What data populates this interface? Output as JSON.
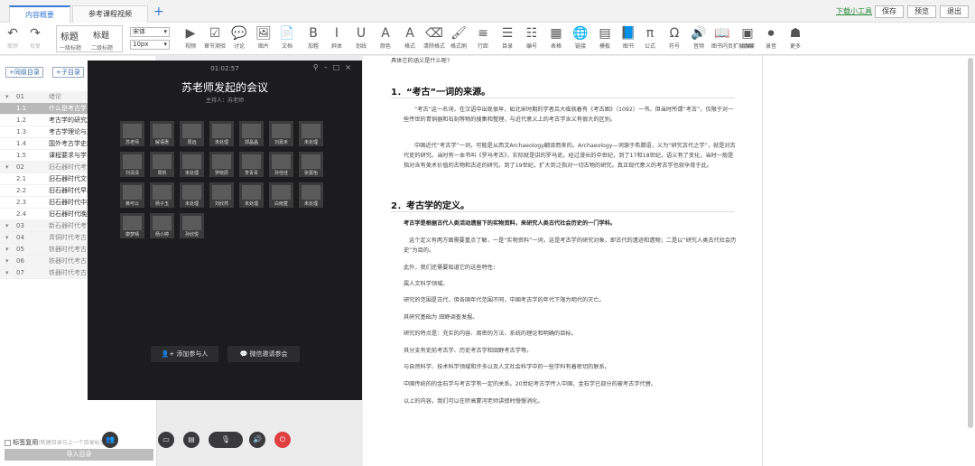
{
  "tabs": [
    "内容概要",
    "参考课程视频"
  ],
  "top_actions": {
    "tool": "下载小工具",
    "save": "保存",
    "preview": "预览",
    "exit": "退出"
  },
  "toolbar": {
    "undo": "撤销",
    "redo": "恢复",
    "style_labels": {
      "h1": "标题",
      "h2": "标题",
      "h1_sub": "一级标题",
      "h2_sub": "二级标题"
    },
    "font": "宋体",
    "size": "10px",
    "items": [
      {
        "g": "▶",
        "l": "视频"
      },
      {
        "g": "☑",
        "l": "章节测验"
      },
      {
        "g": "💬",
        "l": "讨论"
      },
      {
        "g": "🖼",
        "l": "图片"
      },
      {
        "g": "📄",
        "l": "文档"
      },
      {
        "g": "B",
        "l": "加粗"
      },
      {
        "g": "I",
        "l": "斜体"
      },
      {
        "g": "U",
        "l": "划线"
      },
      {
        "g": "A",
        "l": "颜色"
      },
      {
        "g": "A",
        "l": "格式"
      },
      {
        "g": "⌫",
        "l": "清除格式"
      },
      {
        "g": "🖌",
        "l": "格式刷"
      },
      {
        "g": "≡",
        "l": "行距"
      },
      {
        "g": "☰",
        "l": "目录"
      },
      {
        "g": "☷",
        "l": "编号"
      },
      {
        "g": "▦",
        "l": "表格"
      },
      {
        "g": "🌐",
        "l": "链接"
      },
      {
        "g": "▤",
        "l": "模板"
      },
      {
        "g": "📘",
        "l": "图书"
      },
      {
        "g": "π",
        "l": "公式"
      },
      {
        "g": "Ω",
        "l": "符号"
      },
      {
        "g": "🔊",
        "l": "音频"
      },
      {
        "g": "📖",
        "l": "图书内页扩展阅读"
      },
      {
        "g": "▣",
        "l": "动画"
      },
      {
        "g": "⏺",
        "l": "录音"
      },
      {
        "g": "☗",
        "l": "更多"
      }
    ]
  },
  "left": {
    "add_chapter": "+同级目录",
    "add_sub": "+子目录",
    "rows": [
      {
        "n": "01",
        "t": "绪论",
        "k": "ch"
      },
      {
        "n": "1.1",
        "t": "什么是考古学",
        "k": "sel"
      },
      {
        "n": "1.2",
        "t": "考古学的研究对",
        "k": ""
      },
      {
        "n": "1.3",
        "t": "考古学理论与方",
        "k": ""
      },
      {
        "n": "1.4",
        "t": "国外考古学史简",
        "k": ""
      },
      {
        "n": "1.5",
        "t": "课程要求与学习",
        "k": ""
      },
      {
        "n": "02",
        "t": "旧石器时代考古",
        "k": "ch"
      },
      {
        "n": "2.1",
        "t": "旧石器时代文化",
        "k": ""
      },
      {
        "n": "2.2",
        "t": "旧石器时代早期",
        "k": ""
      },
      {
        "n": "2.3",
        "t": "旧石器时代中期",
        "k": ""
      },
      {
        "n": "2.4",
        "t": "旧石器时代晚期",
        "k": ""
      },
      {
        "n": "03",
        "t": "新石器时代考古",
        "k": "ch"
      },
      {
        "n": "04",
        "t": "青铜时代考古",
        "k": "ch"
      },
      {
        "n": "05",
        "t": "铁器时代考古",
        "k": "ch"
      },
      {
        "n": "06",
        "t": "铁器时代考古",
        "k": "ch"
      },
      {
        "n": "07",
        "t": "铁器时代考古",
        "k": "ch"
      }
    ],
    "reuse_label": "标签复用",
    "reuse_hint": "(新建目录与上一个目录标签相同)",
    "import": "导入目录"
  },
  "meeting": {
    "time": "01:02:57",
    "title": "苏老师发起的会议",
    "host": "主持人：苏老师",
    "participants": [
      "苏老师",
      "解语惠",
      "周远",
      "未处理",
      "郭晶晶",
      "刘嘉禾",
      "未处理",
      "刘清清",
      "周帆",
      "未处理",
      "罗晓辰",
      "李青青",
      "孙佳佳",
      "张嘉怡",
      "黄可以",
      "杨子玉",
      "未处理",
      "刘欣然",
      "未处理",
      "白雨萱",
      "未处理",
      "康梦晴",
      "杨小婷",
      "孙欣悦"
    ],
    "add_btn": "添加参与人",
    "wechat_btn": "微信邀请参会"
  },
  "doc": {
    "intro": "具体它的涵义是什么呢?",
    "h1": "1．“考古”一词的来源。",
    "p1": "“考古”这一名词，在汉语中出现很早，如北宋时期的学者吕大临就着有《考古图》（1092）一书。但当时所谓“考古”，仅限于对一些传世的青铜器和石刻等物的搜集和整理，与近代意义上的考古学含义有很大的区别。",
    "p2": "中国近代“考古学”一词，可能是从西文Archaeology翻译而来的。Archaeology—词源于希腊语，义为“研究古代之学”，就是对古代史的研究。当时有一本书叫《罗马考古》，实际就是讲的罗马史。经过漫长的中世纪，到了17和18世纪，语义有了变化，当时一般是指对含有美术价值的古物和古迹的研究。到了19世纪，扩大到泛指对一切古物的研究。真正现代意义的考古学也就孕育于此。",
    "h2": "2．考古学的定义。",
    "def": "考古学是根据古代人类活动遗留下的实物资料，来研究人类古代社会历史的一门学科。",
    "p3": "这个定义有两方面需要重点了解，一是“实物资料”一词，这是考古学的研究对象，即古代的遗迹和遗物；二是以“研究人类古代社会历史”为目的。",
    "p4": "此外，我们还需要知道它的这些特性：",
    "p5": "属人文科学领域。",
    "p6": "研究的范围是古代，但各国年代范围不同，中国考古学的年代下限为明代的灭亡。",
    "p7": "其研究基础为 田野调查发掘。",
    "p8": "研究的特点是：充实的内容、周密的方法、系统的理论和明确的目标。",
    "p9": "其分支有史前考古学、历史考古学和田野考古学等。",
    "p10": "与自然科学、技术科学领域和许多以及人文社会科学中的一些学科有着密切的联系。",
    "p11": "中国传统的的金石学与考古学有一定的关系。20世纪考古学传入中国，金石学已部分的被考古学代替。",
    "p12": "以上的内容，我们可以在听高蒙河老师讲授时慢慢消化。"
  }
}
